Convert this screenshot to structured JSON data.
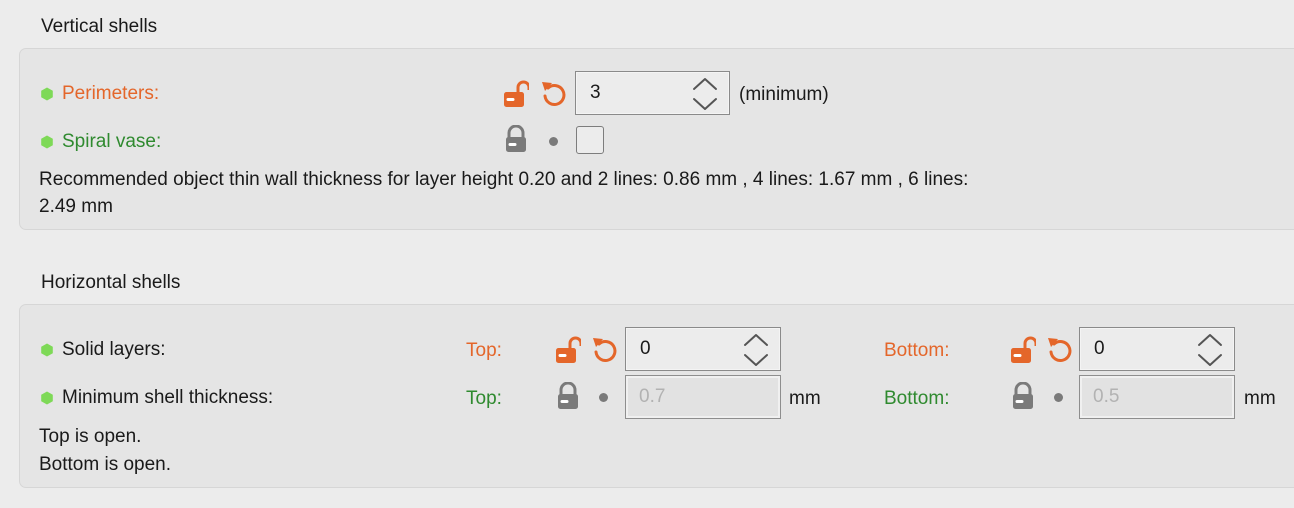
{
  "vertical": {
    "title": "Vertical shells",
    "perimeters": {
      "label": "Perimeters:",
      "value": "3",
      "suffix": "(minimum)"
    },
    "spiral_vase": {
      "label": "Spiral vase:",
      "checked": false
    },
    "note_line1": "Recommended object thin wall thickness for layer height 0.20 and 2 lines: 0.86 mm , 4 lines: 1.67 mm , 6 lines:",
    "note_line2": "2.49 mm"
  },
  "horizontal": {
    "title": "Horizontal shells",
    "solid_layers": {
      "label": "Solid layers:",
      "top_label": "Top:",
      "top_value": "0",
      "bottom_label": "Bottom:",
      "bottom_value": "0"
    },
    "min_shell": {
      "label": "Minimum shell thickness:",
      "top_label": "Top:",
      "top_value": "0.7",
      "top_unit": "mm",
      "bottom_label": "Bottom:",
      "bottom_value": "0.5",
      "bottom_unit": "mm"
    },
    "status_top": "Top is open.",
    "status_bottom": "Bottom is open."
  },
  "colors": {
    "modified": "#e4662a",
    "system": "#2f8a2f",
    "bullet": "#7ed957",
    "lock_gray": "#7a7a7a"
  },
  "icons": [
    "hexagon-bullet-icon",
    "unlock-icon",
    "undo-arrow-icon",
    "lock-icon",
    "dot-icon",
    "spin-arrows-icon"
  ]
}
